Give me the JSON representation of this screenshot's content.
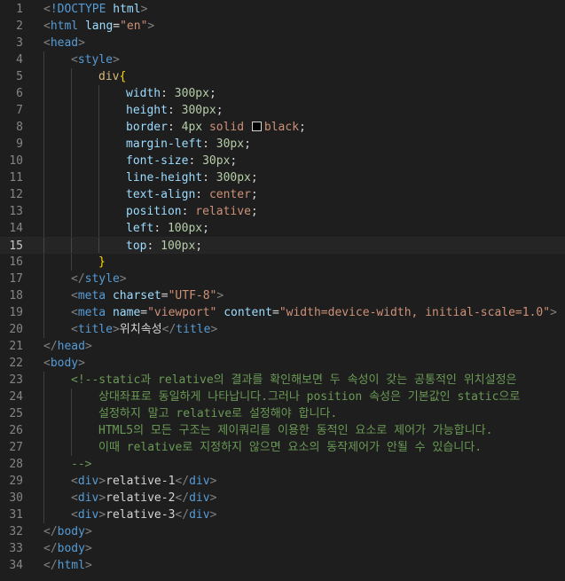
{
  "editor": {
    "theme_colors": {
      "background": "#1e1e1e",
      "line_number": "#858585",
      "tag": "#569cd6",
      "attribute": "#9cdcfe",
      "string": "#ce9178",
      "selector": "#d7ba7d",
      "number": "#b5cea8",
      "comment": "#6a9955"
    },
    "current_line": 15,
    "lines": [
      {
        "n": "1",
        "indent": 0,
        "tokens": [
          [
            "t-punc",
            "<"
          ],
          [
            "t-doc",
            "!DOCTYPE "
          ],
          [
            "t-attr",
            "html"
          ],
          [
            "t-punc",
            ">"
          ]
        ]
      },
      {
        "n": "2",
        "indent": 0,
        "tokens": [
          [
            "t-punc",
            "<"
          ],
          [
            "t-tag",
            "html "
          ],
          [
            "t-attr",
            "lang"
          ],
          [
            "t-text",
            "="
          ],
          [
            "t-str",
            "\"en\""
          ],
          [
            "t-punc",
            ">"
          ]
        ]
      },
      {
        "n": "3",
        "indent": 0,
        "tokens": [
          [
            "t-punc",
            "<"
          ],
          [
            "t-tag",
            "head"
          ],
          [
            "t-punc",
            ">"
          ]
        ]
      },
      {
        "n": "4",
        "indent": 1,
        "tokens": [
          [
            "t-punc",
            "<"
          ],
          [
            "t-tag",
            "style"
          ],
          [
            "t-punc",
            ">"
          ]
        ]
      },
      {
        "n": "5",
        "indent": 2,
        "tokens": [
          [
            "t-sel",
            "div"
          ],
          [
            "t-brace",
            "{"
          ]
        ]
      },
      {
        "n": "6",
        "indent": 3,
        "tokens": [
          [
            "t-prop",
            "width"
          ],
          [
            "t-text",
            ": "
          ],
          [
            "t-num",
            "300px"
          ],
          [
            "t-text",
            ";"
          ]
        ]
      },
      {
        "n": "7",
        "indent": 3,
        "tokens": [
          [
            "t-prop",
            "height"
          ],
          [
            "t-text",
            ": "
          ],
          [
            "t-num",
            "300px"
          ],
          [
            "t-text",
            ";"
          ]
        ]
      },
      {
        "n": "8",
        "indent": 3,
        "tokens": [
          [
            "t-prop",
            "border"
          ],
          [
            "t-text",
            ": "
          ],
          [
            "t-num",
            "4px "
          ],
          [
            "t-val",
            "solid "
          ],
          [
            "swatch",
            ""
          ],
          [
            "t-val",
            "black"
          ],
          [
            "t-text",
            ";"
          ]
        ]
      },
      {
        "n": "9",
        "indent": 3,
        "tokens": [
          [
            "t-prop",
            "margin-left"
          ],
          [
            "t-text",
            ": "
          ],
          [
            "t-num",
            "30px"
          ],
          [
            "t-text",
            ";"
          ]
        ]
      },
      {
        "n": "10",
        "indent": 3,
        "tokens": [
          [
            "t-prop",
            "font-size"
          ],
          [
            "t-text",
            ": "
          ],
          [
            "t-num",
            "30px"
          ],
          [
            "t-text",
            ";"
          ]
        ]
      },
      {
        "n": "11",
        "indent": 3,
        "tokens": [
          [
            "t-prop",
            "line-height"
          ],
          [
            "t-text",
            ": "
          ],
          [
            "t-num",
            "300px"
          ],
          [
            "t-text",
            ";"
          ]
        ]
      },
      {
        "n": "12",
        "indent": 3,
        "tokens": [
          [
            "t-prop",
            "text-align"
          ],
          [
            "t-text",
            ": "
          ],
          [
            "t-val",
            "center"
          ],
          [
            "t-text",
            ";"
          ]
        ]
      },
      {
        "n": "13",
        "indent": 3,
        "tokens": [
          [
            "t-prop",
            "position"
          ],
          [
            "t-text",
            ": "
          ],
          [
            "t-val",
            "relative"
          ],
          [
            "t-text",
            ";"
          ]
        ]
      },
      {
        "n": "14",
        "indent": 3,
        "tokens": [
          [
            "t-prop",
            "left"
          ],
          [
            "t-text",
            ": "
          ],
          [
            "t-num",
            "100px"
          ],
          [
            "t-text",
            ";"
          ]
        ]
      },
      {
        "n": "15",
        "indent": 3,
        "tokens": [
          [
            "t-prop",
            "top"
          ],
          [
            "t-text",
            ": "
          ],
          [
            "t-num",
            "100px"
          ],
          [
            "t-text",
            ";"
          ]
        ]
      },
      {
        "n": "16",
        "indent": 2,
        "tokens": [
          [
            "t-brace",
            "}"
          ]
        ]
      },
      {
        "n": "17",
        "indent": 1,
        "tokens": [
          [
            "t-punc",
            "</"
          ],
          [
            "t-tag",
            "style"
          ],
          [
            "t-punc",
            ">"
          ]
        ]
      },
      {
        "n": "18",
        "indent": 1,
        "tokens": [
          [
            "t-punc",
            "<"
          ],
          [
            "t-tag",
            "meta "
          ],
          [
            "t-attr",
            "charset"
          ],
          [
            "t-text",
            "="
          ],
          [
            "t-str",
            "\"UTF-8\""
          ],
          [
            "t-punc",
            ">"
          ]
        ]
      },
      {
        "n": "19",
        "indent": 1,
        "tokens": [
          [
            "t-punc",
            "<"
          ],
          [
            "t-tag",
            "meta "
          ],
          [
            "t-attr",
            "name"
          ],
          [
            "t-text",
            "="
          ],
          [
            "t-str",
            "\"viewport\" "
          ],
          [
            "t-attr",
            "content"
          ],
          [
            "t-text",
            "="
          ],
          [
            "t-str",
            "\"width=device-width, initial-scale=1.0\""
          ],
          [
            "t-punc",
            ">"
          ]
        ]
      },
      {
        "n": "20",
        "indent": 1,
        "tokens": [
          [
            "t-punc",
            "<"
          ],
          [
            "t-tag",
            "title"
          ],
          [
            "t-punc",
            ">"
          ],
          [
            "t-text",
            "위치속성"
          ],
          [
            "t-punc",
            "</"
          ],
          [
            "t-tag",
            "title"
          ],
          [
            "t-punc",
            ">"
          ]
        ]
      },
      {
        "n": "21",
        "indent": 0,
        "tokens": [
          [
            "t-punc",
            "</"
          ],
          [
            "t-tag",
            "head"
          ],
          [
            "t-punc",
            ">"
          ]
        ]
      },
      {
        "n": "22",
        "indent": 0,
        "tokens": [
          [
            "t-punc",
            "<"
          ],
          [
            "t-tag",
            "body"
          ],
          [
            "t-punc",
            ">"
          ]
        ]
      },
      {
        "n": "23",
        "indent": 1,
        "tokens": [
          [
            "t-com",
            "<!--static과 relative의 결과를 확인해보면 두 속성이 갖는 공통적인 위치설정은"
          ]
        ]
      },
      {
        "n": "24",
        "indent": 2,
        "tokens": [
          [
            "t-com",
            "상대좌표로 동일하게 나타납니다.그러나 position 속성은 기본값인 static으로"
          ]
        ]
      },
      {
        "n": "25",
        "indent": 2,
        "tokens": [
          [
            "t-com",
            "설정하지 말고 relative로 설정해야 합니다."
          ]
        ]
      },
      {
        "n": "26",
        "indent": 2,
        "tokens": [
          [
            "t-com",
            "HTML5의 모든 구조는 제이쿼리를 이용한 동적인 요소로 제어가 가능합니다."
          ]
        ]
      },
      {
        "n": "27",
        "indent": 2,
        "tokens": [
          [
            "t-com",
            "이때 relative로 지정하지 않으면 요소의 동작제어가 안될 수 있습니다."
          ]
        ]
      },
      {
        "n": "28",
        "indent": 1,
        "tokens": [
          [
            "t-com",
            "-->"
          ]
        ]
      },
      {
        "n": "29",
        "indent": 1,
        "tokens": [
          [
            "t-punc",
            "<"
          ],
          [
            "t-tag",
            "div"
          ],
          [
            "t-punc",
            ">"
          ],
          [
            "t-text",
            "relative-1"
          ],
          [
            "t-punc",
            "</"
          ],
          [
            "t-tag",
            "div"
          ],
          [
            "t-punc",
            ">"
          ]
        ]
      },
      {
        "n": "30",
        "indent": 1,
        "tokens": [
          [
            "t-punc",
            "<"
          ],
          [
            "t-tag",
            "div"
          ],
          [
            "t-punc",
            ">"
          ],
          [
            "t-text",
            "relative-2"
          ],
          [
            "t-punc",
            "</"
          ],
          [
            "t-tag",
            "div"
          ],
          [
            "t-punc",
            ">"
          ]
        ]
      },
      {
        "n": "31",
        "indent": 1,
        "tokens": [
          [
            "t-punc",
            "<"
          ],
          [
            "t-tag",
            "div"
          ],
          [
            "t-punc",
            ">"
          ],
          [
            "t-text",
            "relative-3"
          ],
          [
            "t-punc",
            "</"
          ],
          [
            "t-tag",
            "div"
          ],
          [
            "t-punc",
            ">"
          ]
        ]
      },
      {
        "n": "32",
        "indent": 0,
        "tokens": [
          [
            "t-punc",
            "</"
          ],
          [
            "t-tag",
            "body"
          ],
          [
            "t-punc",
            ">"
          ]
        ]
      },
      {
        "n": "33",
        "indent": 0,
        "tokens": [
          [
            "t-punc",
            "</"
          ],
          [
            "t-tag",
            "body"
          ],
          [
            "t-punc",
            ">"
          ]
        ]
      },
      {
        "n": "34",
        "indent": 0,
        "tokens": [
          [
            "t-punc",
            "</"
          ],
          [
            "t-tag",
            "html"
          ],
          [
            "t-punc",
            ">"
          ]
        ]
      }
    ]
  }
}
